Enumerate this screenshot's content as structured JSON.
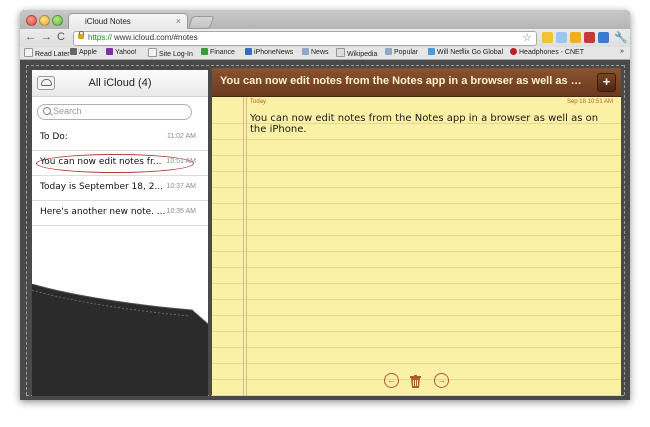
{
  "browser": {
    "tab_title": "iCloud Notes",
    "tab_close": "×",
    "url_scheme": "https://",
    "url_rest": "www.icloud.com/#notes",
    "bookmarks": [
      {
        "label": "Read Later",
        "color": "#f3f3f3"
      },
      {
        "label": "Apple",
        "color": "#666666"
      },
      {
        "label": "Yahoo!",
        "color": "#7b2fa8"
      },
      {
        "label": "Site Log-In",
        "color": "#f3f3f3"
      },
      {
        "label": "Finance",
        "color": "#3a9a3a"
      },
      {
        "label": "iPhoneNews",
        "color": "#3a6ac9"
      },
      {
        "label": "News",
        "color": "#8fa9c9"
      },
      {
        "label": "Wikipedia",
        "color": "#dddddd"
      },
      {
        "label": "Popular",
        "color": "#8fa9c9"
      },
      {
        "label": "Will Netflix Go Global",
        "color": "#4a9ad9"
      },
      {
        "label": "Headphones - CNET",
        "color": "#c01a1a"
      }
    ],
    "overflow": "»"
  },
  "notes_list": {
    "title": "All iCloud (4)",
    "search_placeholder": "Search",
    "items": [
      {
        "title": "To Do:",
        "time": "11:02 AM"
      },
      {
        "title": "You can now edit notes fr...",
        "time": "10:51 AM"
      },
      {
        "title": "Today is September 18, 2...",
        "time": "10:37 AM"
      },
      {
        "title": "Here's another new note. ...",
        "time": "10:35 AM"
      }
    ]
  },
  "note": {
    "header_title": "You can now edit notes from the Notes app in a browser as well as on ...",
    "add_label": "+",
    "date_label": "Today",
    "date": "Sep 18 10:51 AM",
    "body": "You can now edit notes from the Notes app in a browser as well as on the iPhone.",
    "prev_icon": "left-arrow-icon",
    "trash_icon": "trash-icon",
    "next_icon": "right-arrow-icon"
  },
  "colors": {
    "paper": "#fbf1a6",
    "header_brown": "#7a4524",
    "accent_orange": "#b35a2a",
    "selection_ring": "#b63a3a"
  }
}
